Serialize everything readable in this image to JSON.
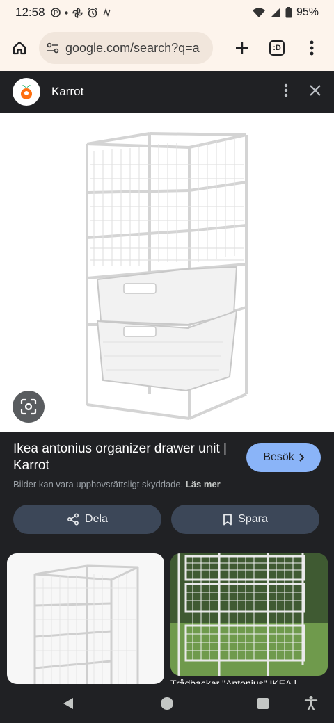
{
  "status_bar": {
    "time": "12:58",
    "battery": "95%"
  },
  "browser": {
    "url": "google.com/search?q=a",
    "tab_count": ":D"
  },
  "sheet": {
    "site_name": "Karrot"
  },
  "result": {
    "title": "Ikea antonius organizer drawer unit | Karrot",
    "visit_label": "Besök",
    "copyright_text": "Bilder kan vara upphovsrättsligt skyddade.",
    "learn_more": "Läs mer",
    "share_label": "Dela",
    "save_label": "Spara"
  },
  "related": [
    {
      "caption": ""
    },
    {
      "caption": "Trådbackar \"Antonius\" IKEA |"
    }
  ],
  "colors": {
    "accent": "#8ab4f8",
    "background": "#202124",
    "chip": "#3c4758",
    "browser_chrome": "#fdf4ec"
  }
}
